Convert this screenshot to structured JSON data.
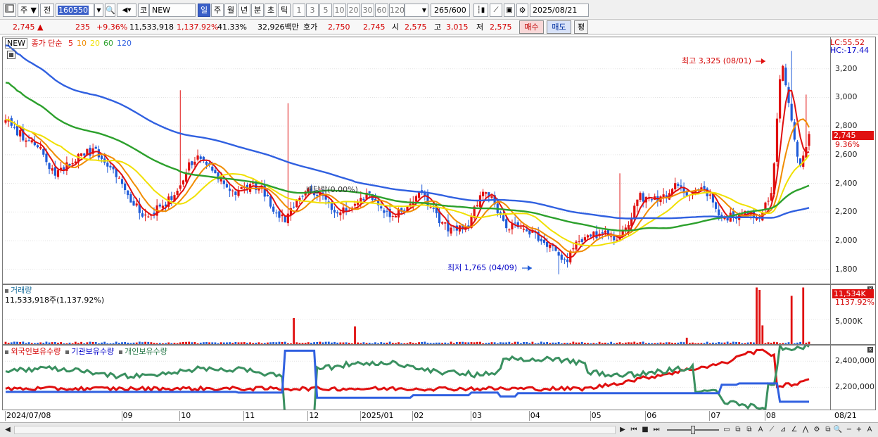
{
  "toolbar": {
    "period_prefix": "주",
    "type": "전",
    "code": "160550",
    "market": "코",
    "stock_name": "NEW",
    "periods": [
      "일",
      "주",
      "월",
      "년",
      "분",
      "초",
      "틱"
    ],
    "selected_period": "일",
    "minutes": [
      "1",
      "3",
      "5",
      "10",
      "20",
      "30",
      "60",
      "120"
    ],
    "count": "265",
    "count_total": "/600",
    "date": "2025/08/21"
  },
  "quote": {
    "price": "2,745",
    "change_arrow": "▲",
    "change": "235",
    "change_pct": "+9.36%",
    "volume": "11,533,918",
    "volume_ratio": "1,137.92%",
    "turnover": "41.33%",
    "amount": "32,926백만",
    "hoga_label": "호가",
    "ask": "2,750",
    "bid": "2,745",
    "open_label": "시",
    "open": "2,575",
    "high_label": "고",
    "high": "3,015",
    "low_label": "저",
    "low": "2,575",
    "buy_button": "매수",
    "sell_button": "매도",
    "eval_button": "평"
  },
  "price_panel": {
    "name": "NEW",
    "legend_label": "종가 단순",
    "ma_periods": [
      "5",
      "10",
      "20",
      "60",
      "120"
    ],
    "lc": "LC:55.52",
    "hc": "HC:-17.44",
    "y_ticks": [
      "3,200",
      "3,000",
      "2,800",
      "2,600",
      "2,400",
      "2,200",
      "2,000",
      "1,800"
    ],
    "price_flag": "2,745",
    "pct_flag": "9.36%",
    "high_annotation": "최고 3,325 (08/01)",
    "low_annotation": "최저 1,765 (04/09)",
    "event_annotation": "배당락(0.00%)"
  },
  "volume_panel": {
    "title": "거래량",
    "info": "11,533,918주(1,137.92%)",
    "flag": "11,534K",
    "flag_pct": "1137.92%",
    "y_tick": "5,000K"
  },
  "holdings_panel": {
    "foreign": "외국인보유수량",
    "institution": "기관보유수량",
    "individual": "개인보유수량",
    "y_ticks": [
      "2,400,000",
      "2,200,000"
    ]
  },
  "x_axis": {
    "labels": [
      "2024/07/08",
      "09",
      "10",
      "11",
      "12",
      "2025/01",
      "02",
      "03",
      "04",
      "05",
      "06",
      "07",
      "08"
    ],
    "end_label": "08/21"
  },
  "colors": {
    "up": "#e01010",
    "down": "#1f5bd8",
    "ma5": "#e01010",
    "ma10": "#f08c00",
    "ma20": "#f0e000",
    "ma60": "#2ca02c",
    "ma120": "#3060e0",
    "foreign": "#e01010",
    "institution": "#3060e0",
    "individual": "#3a9060"
  },
  "chart_data": {
    "type": "candlestick",
    "x_start": "2024/07/08",
    "x_end": "2025/08/21",
    "ylim": [
      1700,
      3420
    ],
    "close_anchors": [
      [
        0,
        2840
      ],
      [
        5,
        2740
      ],
      [
        12,
        2620
      ],
      [
        16,
        2450
      ],
      [
        20,
        2540
      ],
      [
        26,
        2620
      ],
      [
        30,
        2620
      ],
      [
        35,
        2500
      ],
      [
        40,
        2330
      ],
      [
        45,
        2180
      ],
      [
        50,
        2220
      ],
      [
        56,
        2330
      ],
      [
        60,
        2520
      ],
      [
        64,
        2590
      ],
      [
        68,
        2480
      ],
      [
        72,
        2380
      ],
      [
        76,
        2330
      ],
      [
        80,
        2390
      ],
      [
        84,
        2370
      ],
      [
        88,
        2230
      ],
      [
        92,
        2140
      ],
      [
        96,
        2270
      ],
      [
        100,
        2360
      ],
      [
        104,
        2300
      ],
      [
        108,
        2220
      ],
      [
        112,
        2210
      ],
      [
        116,
        2300
      ],
      [
        120,
        2330
      ],
      [
        124,
        2200
      ],
      [
        128,
        2190
      ],
      [
        132,
        2230
      ],
      [
        136,
        2320
      ],
      [
        140,
        2240
      ],
      [
        144,
        2100
      ],
      [
        148,
        2080
      ],
      [
        152,
        2090
      ],
      [
        156,
        2340
      ],
      [
        160,
        2280
      ],
      [
        164,
        2090
      ],
      [
        168,
        2120
      ],
      [
        172,
        2060
      ],
      [
        176,
        2010
      ],
      [
        180,
        1940
      ],
      [
        184,
        1850
      ],
      [
        188,
        1980
      ],
      [
        192,
        2030
      ],
      [
        196,
        2060
      ],
      [
        200,
        2010
      ],
      [
        204,
        2100
      ],
      [
        208,
        2310
      ],
      [
        212,
        2290
      ],
      [
        216,
        2290
      ],
      [
        220,
        2390
      ],
      [
        224,
        2300
      ],
      [
        228,
        2390
      ],
      [
        232,
        2280
      ],
      [
        236,
        2150
      ],
      [
        240,
        2180
      ],
      [
        244,
        2200
      ],
      [
        248,
        2170
      ],
      [
        252,
        2380
      ],
      [
        255,
        3300
      ],
      [
        258,
        2850
      ],
      [
        261,
        2500
      ],
      [
        264,
        2745
      ]
    ],
    "ma_periods": [
      5,
      10,
      20,
      60,
      120
    ],
    "volume_spikes": [
      [
        99,
        5.3
      ],
      [
        120,
        3.6
      ],
      [
        234,
        1.3
      ],
      [
        258,
        11.5
      ],
      [
        259,
        11.0
      ],
      [
        260,
        3.8
      ],
      [
        270,
        9.8
      ],
      [
        274,
        11.5
      ]
    ],
    "holdings_ylim": [
      2030000,
      2520000
    ]
  }
}
